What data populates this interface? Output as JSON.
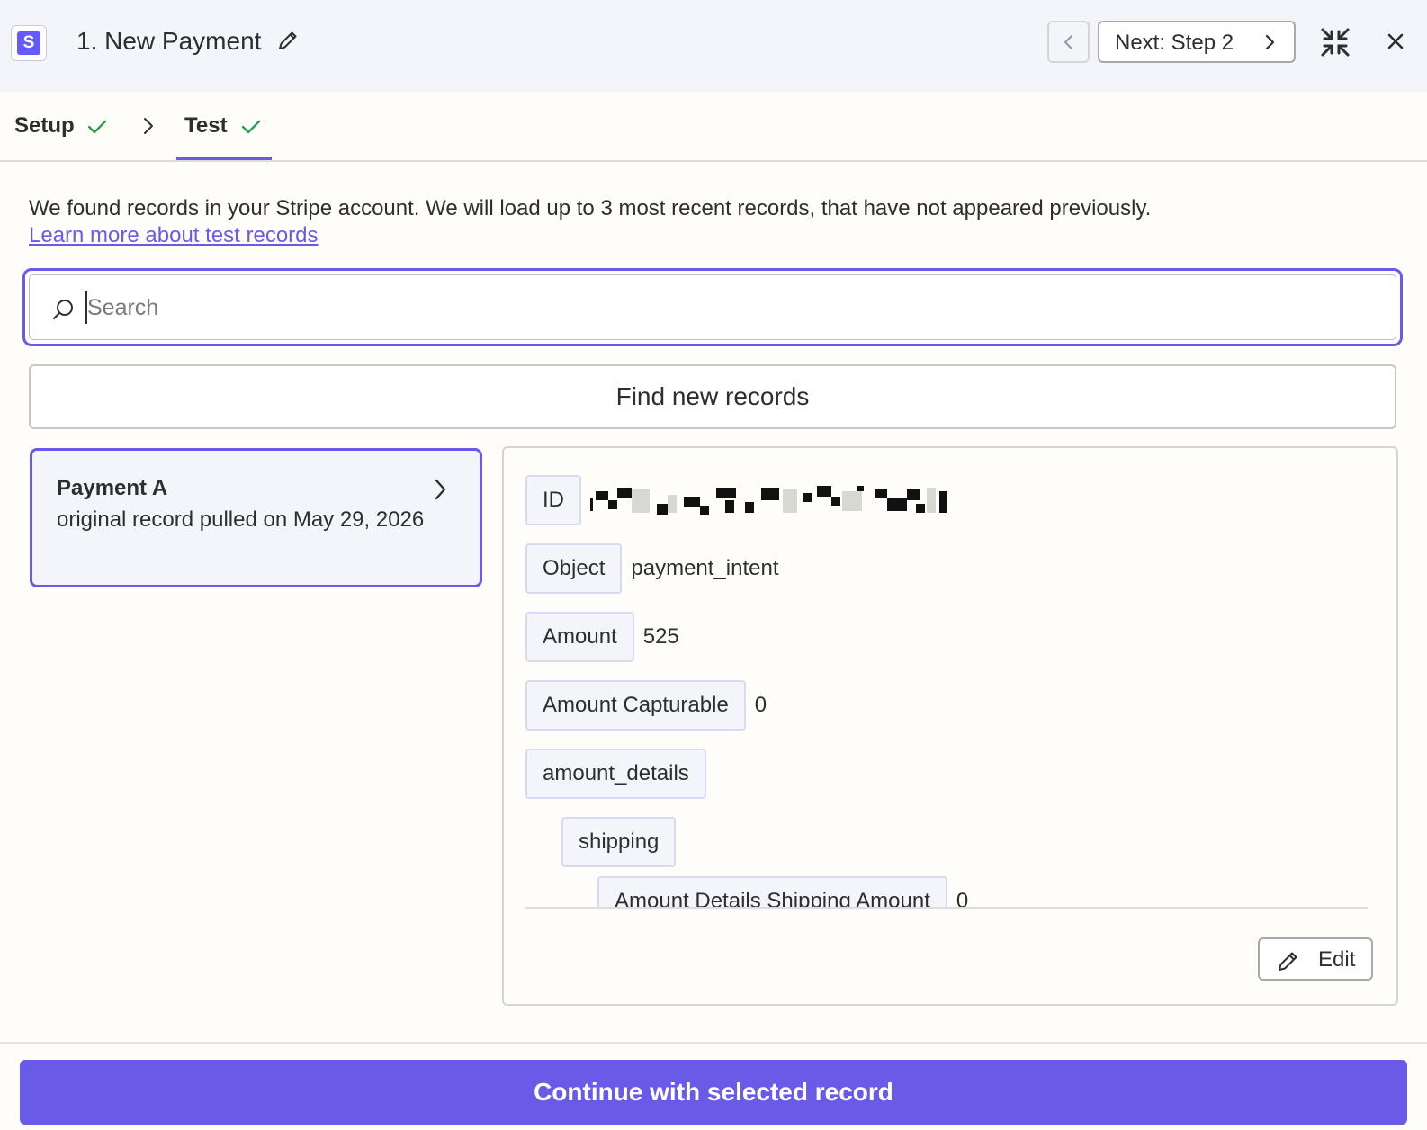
{
  "header": {
    "app_icon_letter": "S",
    "title": "1. New Payment",
    "next_label": "Next: Step 2"
  },
  "tabs": [
    {
      "label": "Setup",
      "completed": true
    },
    {
      "label": "Test",
      "completed": true,
      "active": true
    }
  ],
  "info": {
    "text": "We found records in your Stripe account. We will load up to 3 most recent records, that have not appeared previously.",
    "link": "Learn more about test records"
  },
  "search": {
    "placeholder": "Search",
    "value": ""
  },
  "find_button": "Find new records",
  "record": {
    "name": "Payment A",
    "subtitle": "original record pulled on May 29, 2026"
  },
  "fields": [
    {
      "key": "ID",
      "value": "",
      "redacted": true
    },
    {
      "key": "Object",
      "value": "payment_intent"
    },
    {
      "key": "Amount",
      "value": "525"
    },
    {
      "key": "Amount Capturable",
      "value": "0"
    },
    {
      "key": "amount_details",
      "value": ""
    },
    {
      "key": "shipping",
      "value": ""
    },
    {
      "key": "Amount Details Shipping Amount",
      "value": "0"
    }
  ],
  "edit_button": "Edit",
  "continue_button": "Continue with selected record",
  "colors": {
    "accent": "#695be8",
    "check": "#2f9e4f",
    "stripe": "#635bff"
  }
}
